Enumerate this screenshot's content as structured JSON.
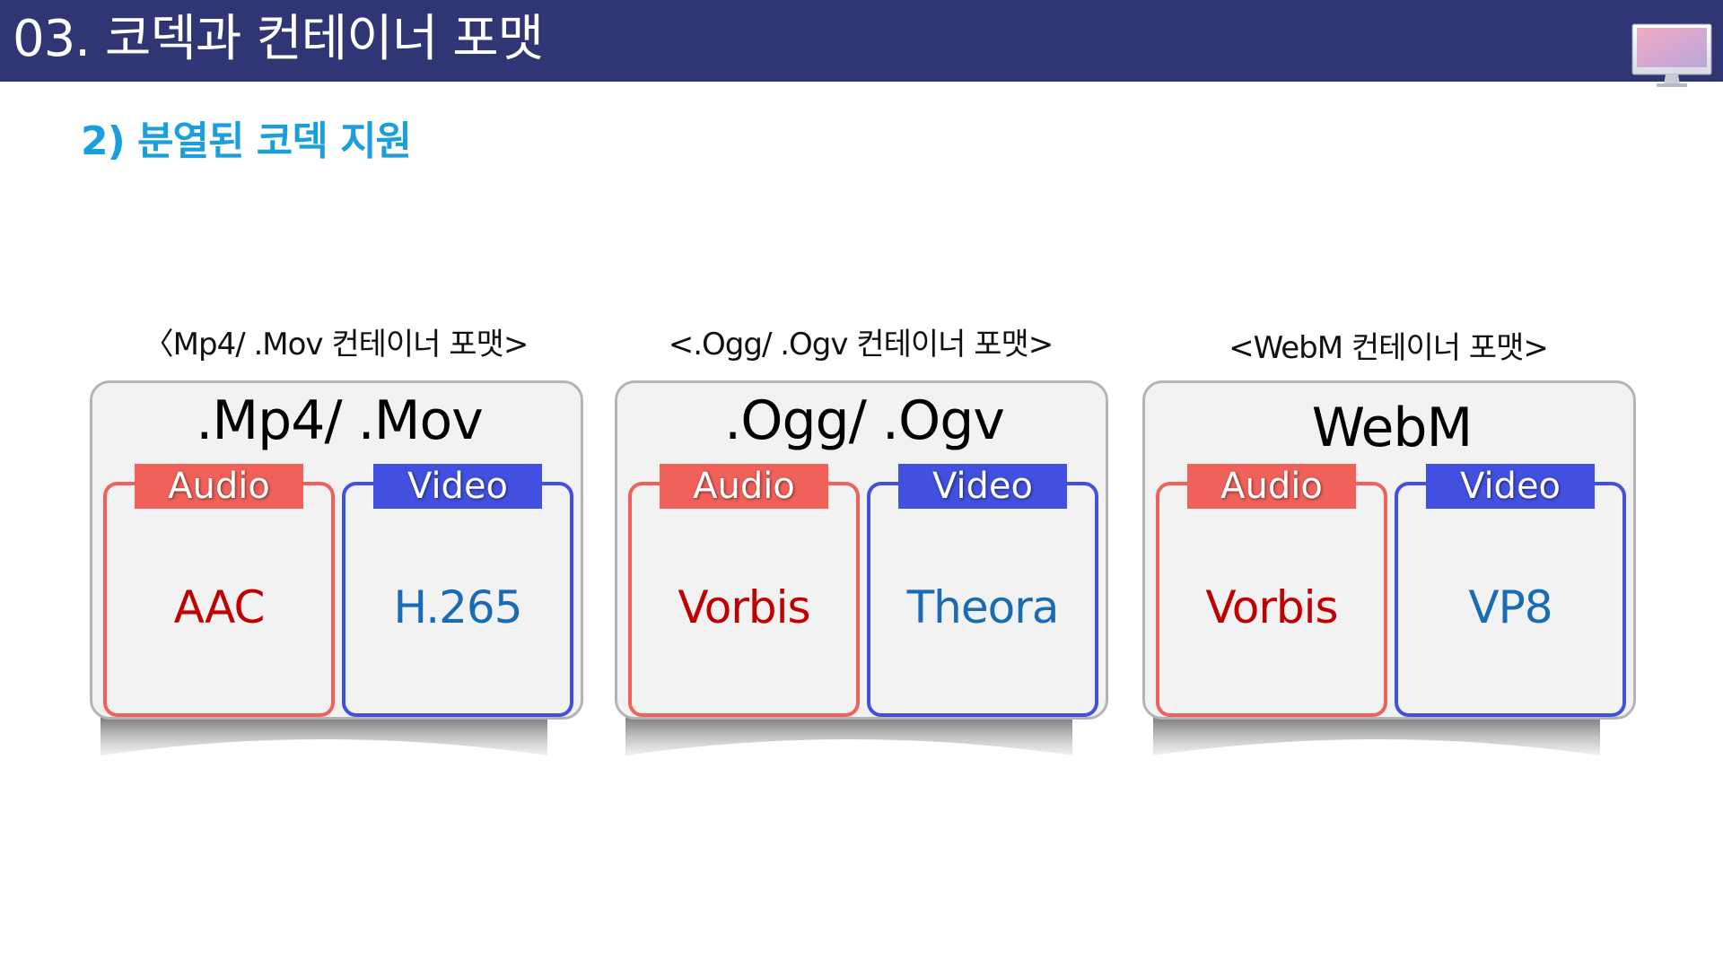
{
  "header": {
    "title": "03. 코덱과 컨테이너 포맷",
    "icon": "monitor-icon"
  },
  "subtitle": "2) 분열된 코덱 지원",
  "colors": {
    "header_bg": "#303673",
    "subtitle": "#1a9fdd",
    "audio_accent": "#f0615a",
    "video_accent": "#4250e0",
    "audio_codec_text": "#c00000",
    "video_codec_text": "#1a6bb5"
  },
  "containers": [
    {
      "caption": "〈Mp4/ .Mov 컨테이너 포맷>",
      "title": ".Mp4/ .Mov",
      "audio_label": "Audio",
      "video_label": "Video",
      "audio_codec": "AAC",
      "video_codec": "H.265"
    },
    {
      "caption": "<.Ogg/  .Ogv 컨테이너 포맷>",
      "title": ".Ogg/ .Ogv",
      "audio_label": "Audio",
      "video_label": "Video",
      "audio_codec": "Vorbis",
      "video_codec": "Theora"
    },
    {
      "caption": "<WebM 컨테이너 포맷>",
      "title": "WebM",
      "audio_label": "Audio",
      "video_label": "Video",
      "audio_codec": "Vorbis",
      "video_codec": "VP8"
    }
  ]
}
